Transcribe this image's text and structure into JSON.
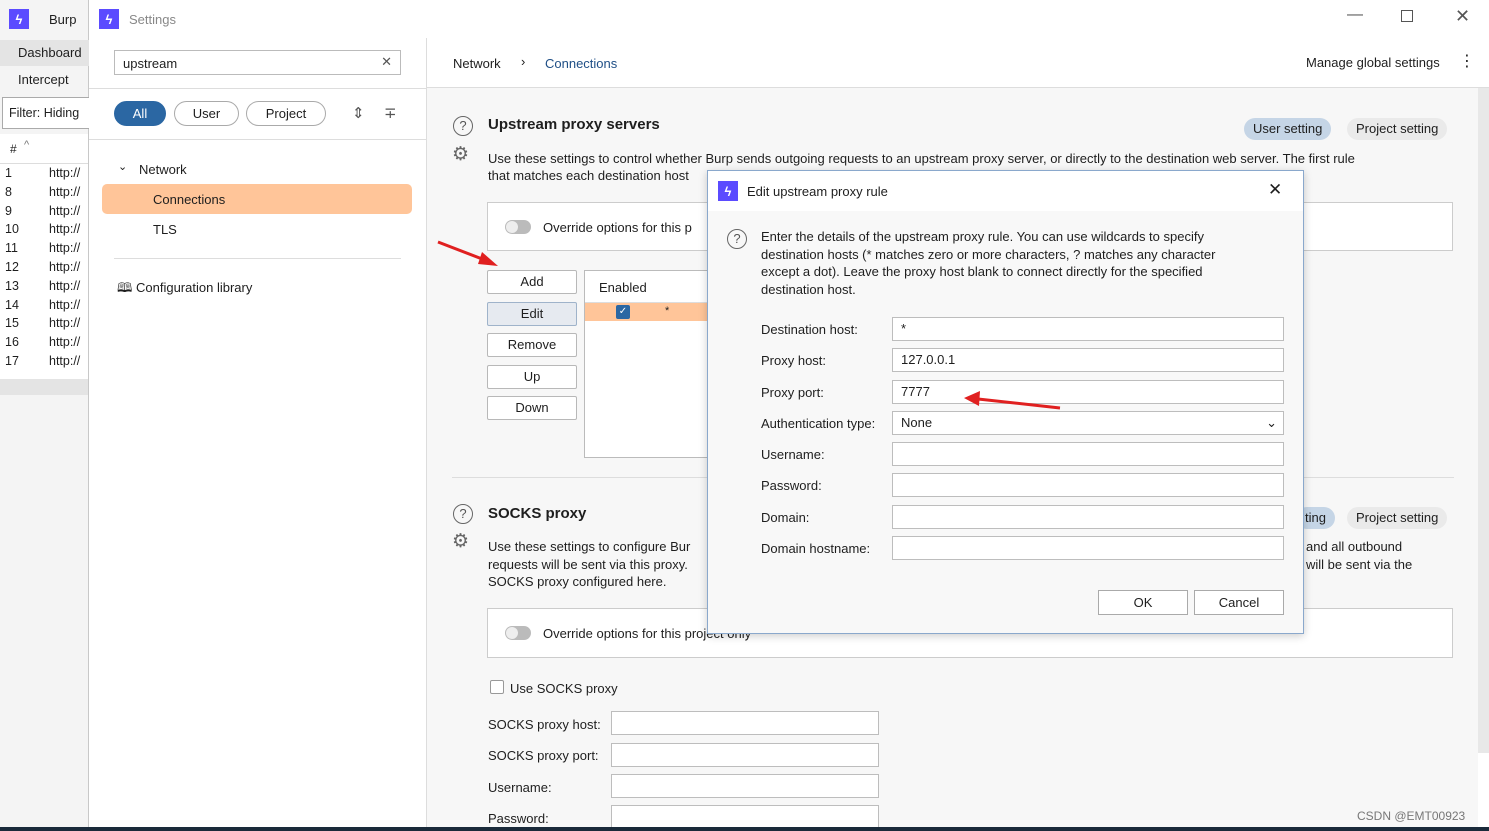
{
  "burp": {
    "title": "Burp",
    "tabs": [
      "Dashboard",
      "Intercept"
    ],
    "filter": "Filter: Hiding",
    "col_hash": "#",
    "rows": [
      {
        "n": "1",
        "u": "http://"
      },
      {
        "n": "8",
        "u": "http://"
      },
      {
        "n": "9",
        "u": "http://"
      },
      {
        "n": "10",
        "u": "http://"
      },
      {
        "n": "11",
        "u": "http://"
      },
      {
        "n": "12",
        "u": "http://"
      },
      {
        "n": "13",
        "u": "http://"
      },
      {
        "n": "14",
        "u": "http://"
      },
      {
        "n": "15",
        "u": "http://"
      },
      {
        "n": "16",
        "u": "http://"
      },
      {
        "n": "17",
        "u": "http://"
      }
    ]
  },
  "settings": {
    "title": "Settings",
    "search": "upstream",
    "filters": [
      "All",
      "User",
      "Project"
    ],
    "tree": {
      "group": "Network",
      "items": [
        "Connections",
        "TLS"
      ]
    },
    "library": "Configuration library"
  },
  "breadcrumb": {
    "parent": "Network",
    "current": "Connections",
    "manage": "Manage global settings"
  },
  "upstream": {
    "title": "Upstream proxy servers",
    "user_setting": "User setting",
    "project_setting": "Project setting",
    "desc1": "Use these settings to  control whether Burp sends outgoing requests to an upstream proxy server, or directly to the destination web server. The first rule",
    "desc2": "that matches each destination host",
    "override": "Override options for this p",
    "buttons": [
      "Add",
      "Edit",
      "Remove",
      "Up",
      "Down"
    ],
    "col_enabled": "Enabled",
    "row_dest": "*"
  },
  "socks": {
    "title": "SOCKS proxy",
    "user_setting": "ting",
    "project_setting": "Project setting",
    "desc1": "Use these settings to configure Bur",
    "desc2": "requests will be sent via this proxy.",
    "desc3": "SOCKS proxy configured here.",
    "desc1r": "and all outbound",
    "desc2r": "will be sent via the",
    "override": "Override options for this project only",
    "use": "Use SOCKS proxy",
    "host": "SOCKS proxy host:",
    "port": "SOCKS proxy port:",
    "username": "Username:",
    "password": "Password:"
  },
  "dialog": {
    "title": "Edit upstream proxy rule",
    "help": "Enter the details of the upstream proxy rule. You can use wildcards to specify destination hosts (* matches zero or more characters, ? matches any character except a dot). Leave the proxy host blank to connect directly for the specified destination host.",
    "labels": [
      "Destination host:",
      "Proxy host:",
      "Proxy port:",
      "Authentication type:",
      "Username:",
      "Password:",
      "Domain:",
      "Domain hostname:"
    ],
    "values": [
      "*",
      "127.0.0.1",
      "7777",
      "None",
      "",
      "",
      "",
      ""
    ],
    "ok": "OK",
    "cancel": "Cancel"
  },
  "watermark": "CSDN @EMT00923",
  "colors": {
    "accent": "#2b67a3",
    "selected": "#ffc599",
    "logo": "#5b4bff",
    "arrow": "#e02020"
  }
}
